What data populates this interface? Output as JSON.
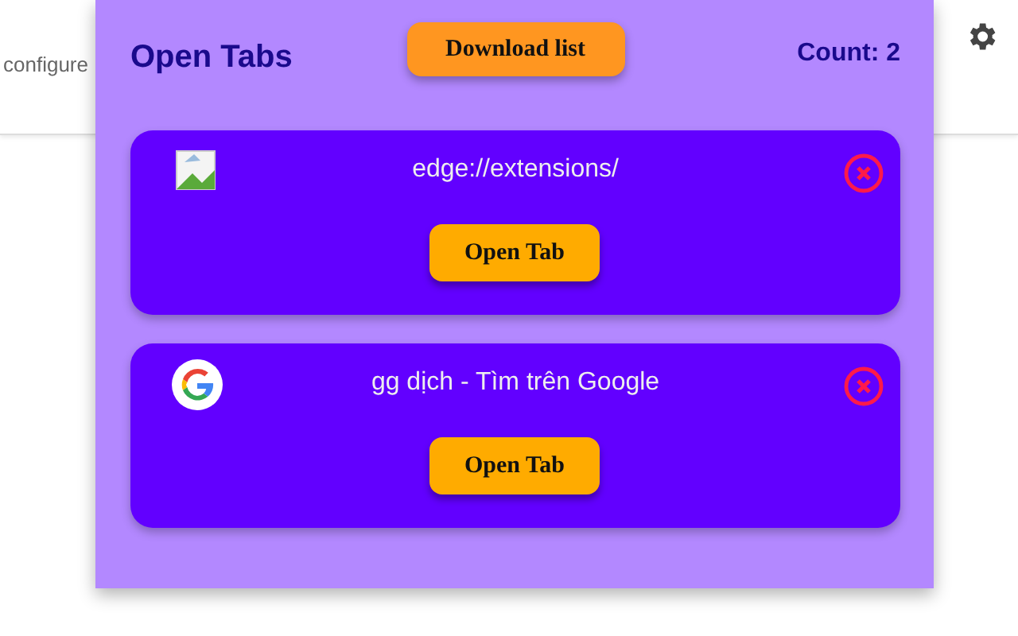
{
  "background_page": {
    "hint_text": "configure"
  },
  "popup": {
    "title": "Open Tabs",
    "download_button": "Download list",
    "count": "Count: 2"
  },
  "tabs": [
    {
      "title": "edge://extensions/",
      "kind": "broken",
      "open_button": "Open Tab"
    },
    {
      "title": "gg dịch - Tìm trên Google",
      "kind": "google",
      "open_button": "Open Tab"
    }
  ]
}
